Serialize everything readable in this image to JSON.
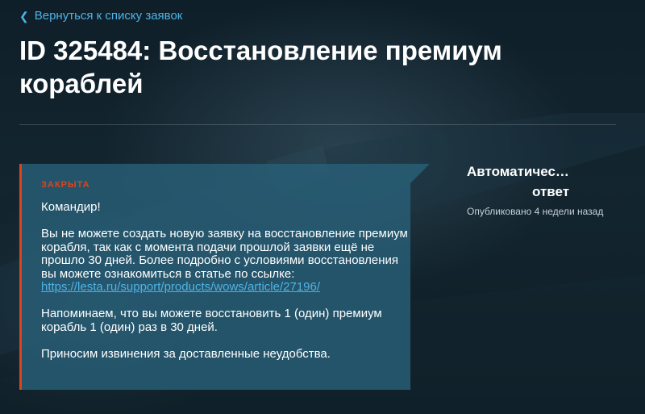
{
  "header": {
    "back_link": "Вернуться к списку заявок",
    "title": "ID 325484: Восстановление премиум кораблей"
  },
  "ticket": {
    "status": "ЗАКРЫТА",
    "message": {
      "greeting": "Командир!",
      "paragraph1": "Вы не можете создать новую заявку на восстановление премиум корабля, так как с момента подачи прошлой заявки ещё не прошло 30 дней. Более подробно с условиями восстановления вы можете ознакомиться в статье по ссылке:",
      "link": "https://lesta.ru/support/products/wows/article/27196/",
      "paragraph2": "Напоминаем, что вы можете восстановить 1 (один) премиум корабль 1 (один) раз в 30 дней.",
      "paragraph3": "Приносим извинения за доставленные неудобства."
    }
  },
  "sidebar": {
    "author_line1": "Автоматичес…",
    "author_line2": "ответ",
    "published": "Опубликовано 4 недели назад"
  },
  "colors": {
    "accent_link": "#4fb3e6",
    "status_closed": "#e0431b",
    "card_bg": "#285f78"
  }
}
